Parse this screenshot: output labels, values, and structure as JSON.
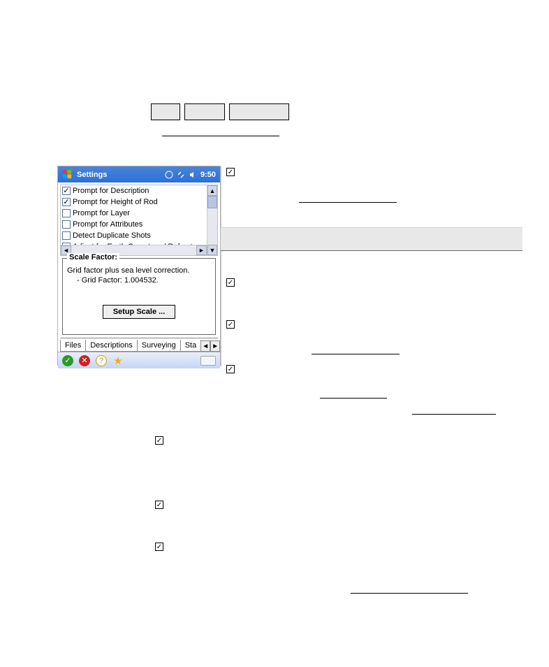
{
  "buttons": {
    "b1": "",
    "b2": "",
    "b3": ""
  },
  "window": {
    "title": "Settings",
    "clock": "9:50",
    "list": [
      {
        "checked": true,
        "label": "Prompt for Description"
      },
      {
        "checked": true,
        "label": "Prompt for Height of Rod"
      },
      {
        "checked": false,
        "label": "Prompt for Layer"
      },
      {
        "checked": false,
        "label": "Prompt for Attributes"
      },
      {
        "checked": false,
        "label": "Detect Duplicate Shots"
      },
      {
        "checked": false,
        "label": "Adjust for Earth Curvature / Refract"
      }
    ],
    "groupbox": {
      "legend": "Scale Factor:",
      "line1": "Grid factor plus sea level correction.",
      "line2": "- Grid Factor: 1.004532.",
      "button": "Setup Scale ..."
    },
    "tabs": {
      "t1": "Files",
      "t2": "Descriptions",
      "t3": "Surveying",
      "t4": "Sta"
    }
  }
}
